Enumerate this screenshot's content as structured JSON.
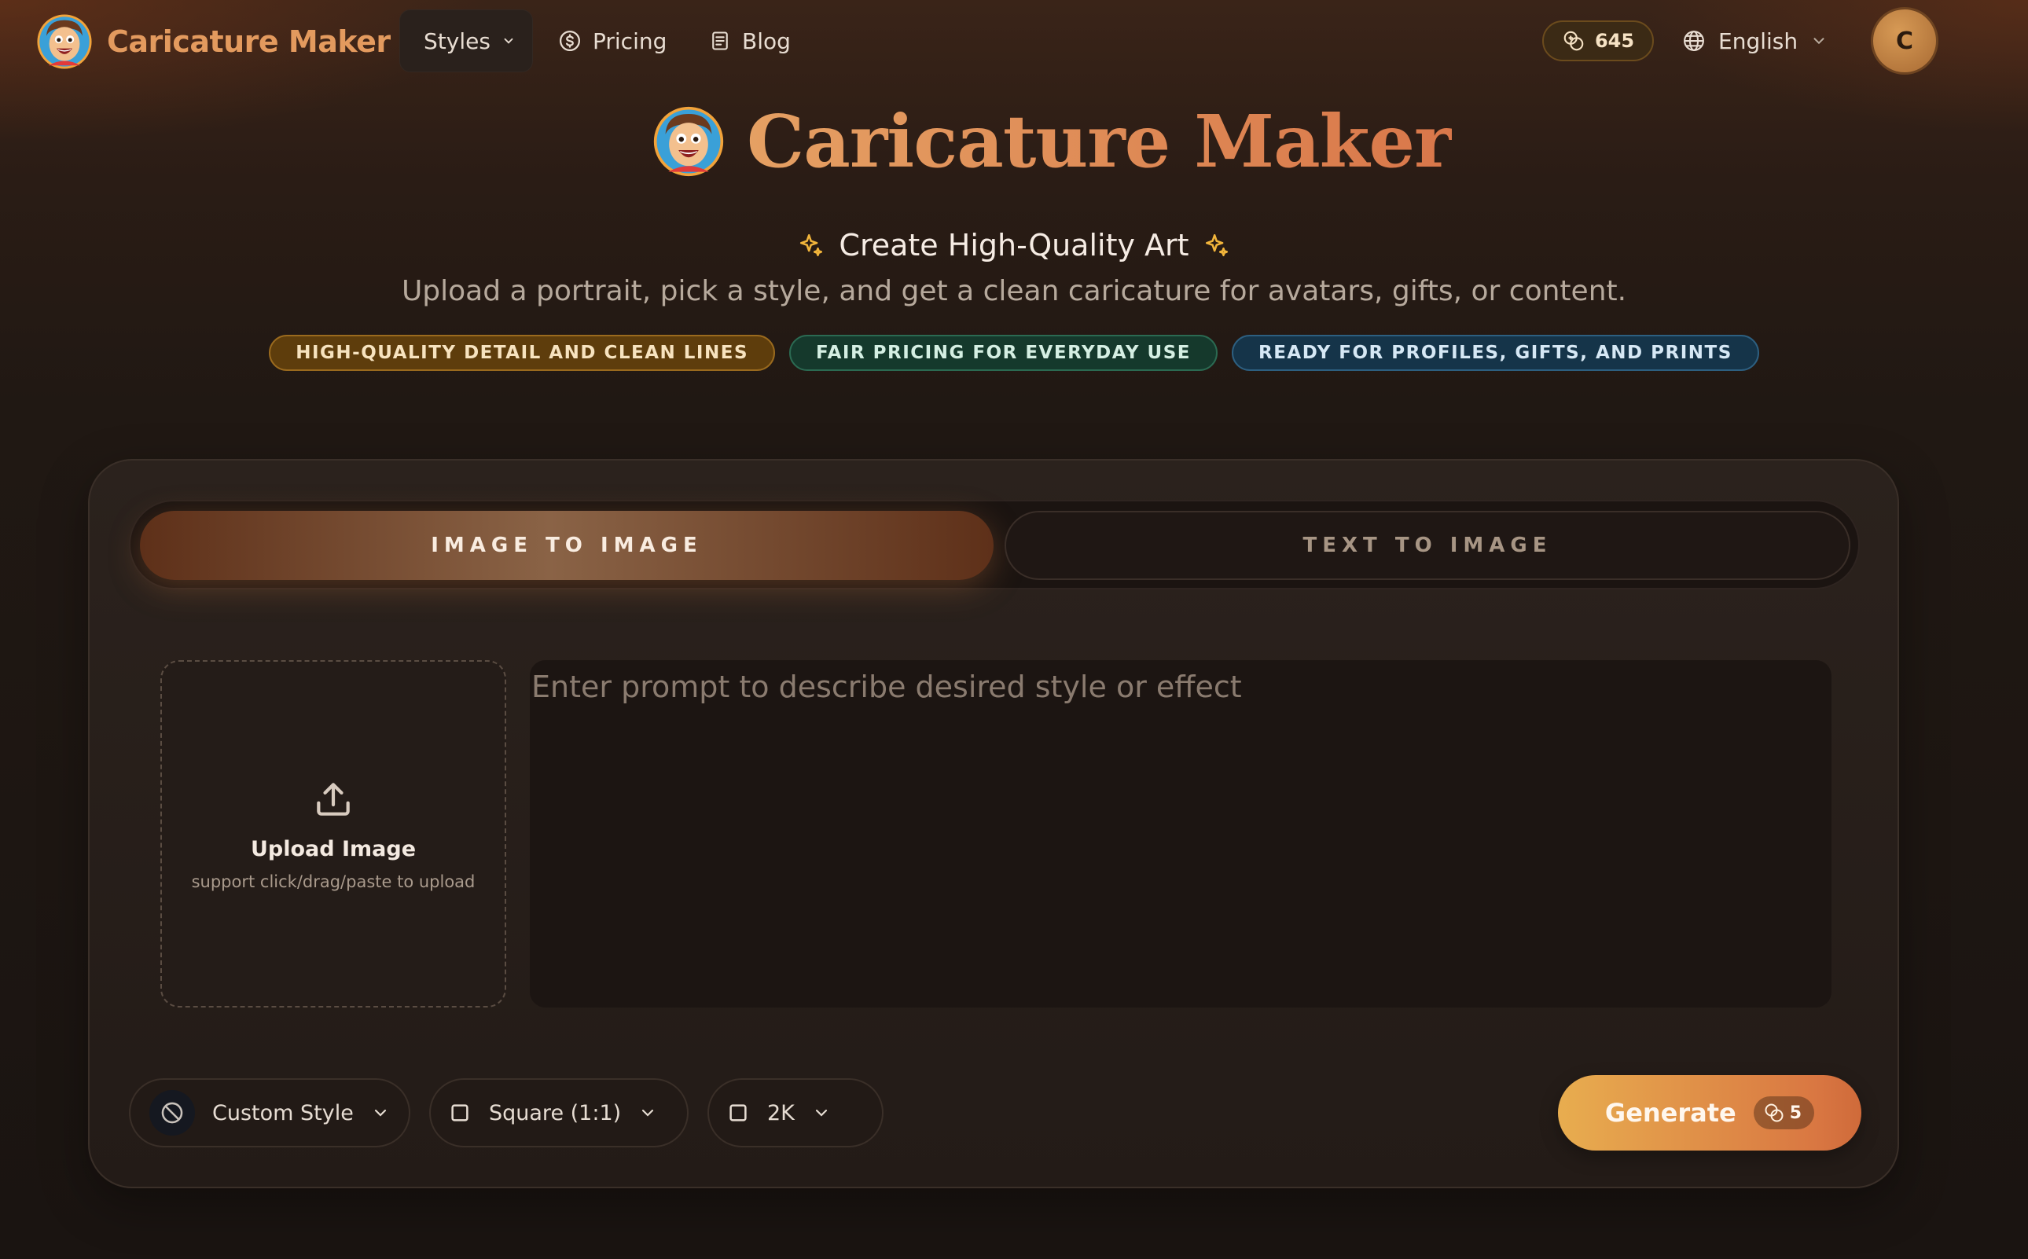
{
  "brand": {
    "name": "Caricature Maker"
  },
  "nav": {
    "styles_label": "Styles",
    "pricing_label": "Pricing",
    "blog_label": "Blog"
  },
  "account": {
    "credits": "645",
    "language": "English",
    "avatar_initial": "C"
  },
  "hero": {
    "title": "Caricature Maker",
    "subtitle": "Create High-Quality Art",
    "description": "Upload a portrait, pick a style, and get a clean caricature for avatars, gifts, or content.",
    "badges": [
      "HIGH-QUALITY DETAIL AND CLEAN LINES",
      "FAIR PRICING FOR EVERYDAY USE",
      "READY FOR PROFILES, GIFTS, AND PRINTS"
    ]
  },
  "tabs": [
    {
      "label": "IMAGE TO IMAGE",
      "active": true
    },
    {
      "label": "TEXT TO IMAGE",
      "active": false
    }
  ],
  "upload": {
    "title": "Upload Image",
    "subtitle": "support click/drag/paste to upload"
  },
  "prompt": {
    "placeholder": "Enter prompt to describe desired style or effect",
    "value": ""
  },
  "controls": {
    "style": "Custom Style",
    "aspect_ratio": "Square (1:1)",
    "resolution": "2K"
  },
  "generate": {
    "label": "Generate",
    "cost": "5"
  },
  "colors": {
    "accent": "#e39a5e",
    "generate_start": "#e8ad4f",
    "generate_end": "#d97742",
    "badge_gold": "#5e3d0c",
    "badge_green": "#15392c",
    "badge_blue": "#153449"
  },
  "icons": {
    "logo": "caricature-face-logo",
    "styles_chevron": "chevron-down-icon",
    "pricing": "dollar-circle-icon",
    "blog": "document-icon",
    "credits": "coins-icon",
    "language": "globe-icon",
    "sparkle": "sparkle-icon",
    "upload": "upload-arrow-icon",
    "style": "no-style-icon",
    "ratio": "square-icon"
  }
}
